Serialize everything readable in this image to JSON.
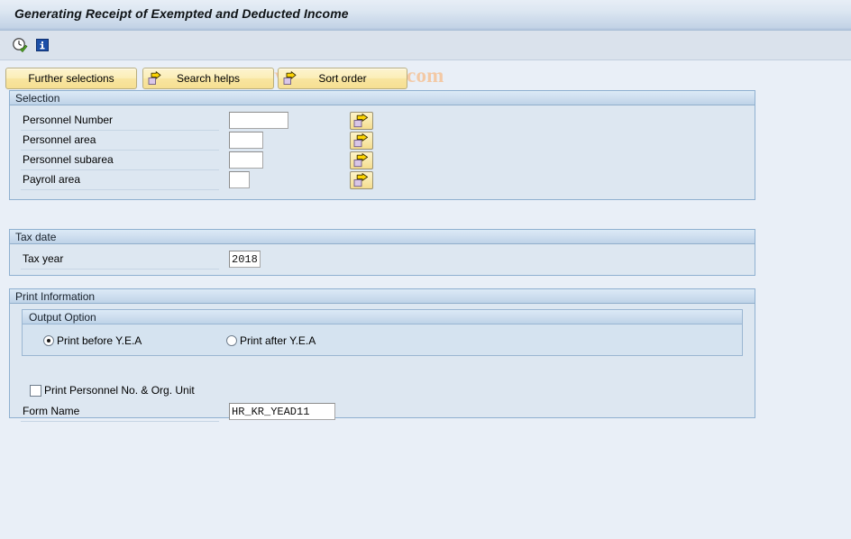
{
  "window": {
    "title": "Generating Receipt of Exempted and Deducted Income"
  },
  "toolbar": {
    "execute_icon": "execute-clock-check-icon",
    "info_icon": "information-icon"
  },
  "watermark": {
    "text": "© www.tutorialkart.com",
    "color": "#f3c9a5"
  },
  "buttons": {
    "further_selections": "Further selections",
    "search_helps": "Search helps",
    "sort_order": "Sort order"
  },
  "selection": {
    "header": "Selection",
    "fields": [
      {
        "label": "Personnel Number",
        "value": "",
        "width": 66
      },
      {
        "label": "Personnel area",
        "value": "",
        "width": 38
      },
      {
        "label": "Personnel subarea",
        "value": "",
        "width": 38
      },
      {
        "label": "Payroll area",
        "value": "",
        "width": 23
      }
    ],
    "matchcode_icon": "multiple-selection-arrow-icon"
  },
  "tax_date": {
    "header": "Tax date",
    "year_label": "Tax year",
    "year_value": "2018"
  },
  "print_information": {
    "header": "Print Information",
    "output_option": {
      "header": "Output Option",
      "options": [
        {
          "label": "Print before Y.E.A",
          "selected": true
        },
        {
          "label": "Print after Y.E.A",
          "selected": false
        }
      ]
    },
    "print_personnel_checkbox": {
      "label": "Print Personnel  No. & Org. Unit",
      "checked": false
    },
    "form_name_label": "Form Name",
    "form_name_value": "HR_KR_YEAD11"
  }
}
